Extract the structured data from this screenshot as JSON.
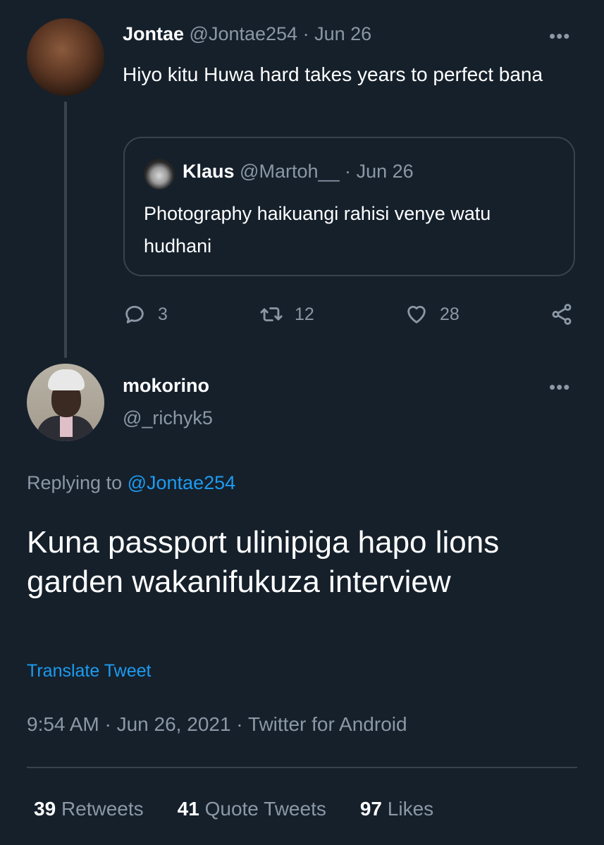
{
  "parent_tweet": {
    "display_name": "Jontae",
    "handle": "@Jontae254",
    "separator": "·",
    "date": "Jun 26",
    "more": "•••",
    "text": "Hiyo kitu Huwa hard takes years to perfect bana",
    "quoted_tweet": {
      "display_name": "Klaus",
      "handle": "@Martoh__",
      "separator": "·",
      "date": "Jun 26",
      "text": "Photography haikuangi rahisi venye watu hudhani"
    },
    "actions": {
      "replies": "3",
      "retweets": "12",
      "likes": "28"
    }
  },
  "reply_tweet": {
    "display_name": "mokorino",
    "handle": "@_richyk5",
    "more": "•••",
    "replying_prefix": "Replying to",
    "replying_to": "@Jontae254",
    "text": "Kuna passport ulinipiga hapo lions garden wakanifukuza interview",
    "translate": "Translate Tweet",
    "timestamp": "9:54 AM · Jun 26, 2021 · Twitter for Android",
    "stats": [
      {
        "count": "39",
        "label": "Retweets"
      },
      {
        "count": "41",
        "label": "Quote Tweets"
      },
      {
        "count": "97",
        "label": "Likes"
      }
    ]
  },
  "colors": {
    "background": "#15202b",
    "muted": "#8b98a5",
    "accent": "#1d9bf0",
    "border": "#38444d"
  }
}
